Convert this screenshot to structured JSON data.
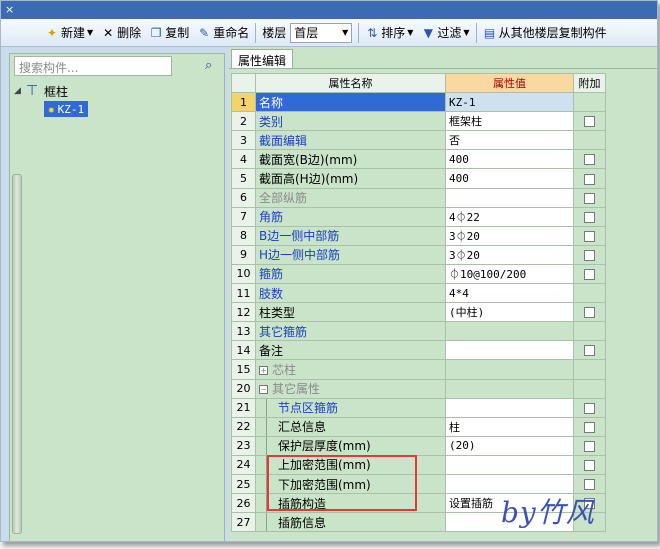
{
  "window": {
    "close_glyph": "×"
  },
  "toolbar": {
    "new": "新建",
    "delete": "删除",
    "copy": "复制",
    "rename": "重命名",
    "floor_label": "楼层",
    "floor_value": "首层",
    "sort": "排序",
    "filter": "过滤",
    "copy_from_floor": "从其他楼层复制构件"
  },
  "left": {
    "search_placeholder": "搜索构件...",
    "tree": {
      "root": "框柱",
      "child": "KZ-1"
    }
  },
  "right": {
    "tab": "属性编辑",
    "headers": {
      "name": "属性名称",
      "value": "属性值",
      "extra": "附加"
    },
    "rows": [
      {
        "num": "1",
        "name": "名称",
        "value": "KZ-1",
        "color": "blue",
        "selected": true
      },
      {
        "num": "2",
        "name": "类别",
        "value": "框架柱",
        "color": "blue",
        "checkbox": true
      },
      {
        "num": "3",
        "name": "截面编辑",
        "value": "否",
        "color": "blue"
      },
      {
        "num": "4",
        "name": "截面宽(B边)(mm)",
        "value": "400",
        "color": "black",
        "checkbox": true
      },
      {
        "num": "5",
        "name": "截面高(H边)(mm)",
        "value": "400",
        "color": "black",
        "checkbox": true
      },
      {
        "num": "6",
        "name": "全部纵筋",
        "value": "",
        "color": "gray",
        "checkbox": true
      },
      {
        "num": "7",
        "name": "角筋",
        "value": "4⏀22",
        "color": "blue",
        "checkbox": true
      },
      {
        "num": "8",
        "name": "B边一侧中部筋",
        "value": "3⏀20",
        "color": "blue",
        "checkbox": true
      },
      {
        "num": "9",
        "name": "H边一侧中部筋",
        "value": "3⏀20",
        "color": "blue",
        "checkbox": true
      },
      {
        "num": "10",
        "name": "箍筋",
        "value": "⏀10@100/200",
        "color": "blue",
        "checkbox": true
      },
      {
        "num": "11",
        "name": "肢数",
        "value": "4*4",
        "color": "blue"
      },
      {
        "num": "12",
        "name": "柱类型",
        "value": "(中柱)",
        "color": "black",
        "checkbox": true
      },
      {
        "num": "13",
        "name": "其它箍筋",
        "value": "",
        "color": "blue"
      },
      {
        "num": "14",
        "name": "备注",
        "value": "",
        "color": "black",
        "checkbox": true
      },
      {
        "num": "15",
        "name": "芯柱",
        "value": "",
        "color": "gray",
        "expander": "+"
      },
      {
        "num": "20",
        "name": "其它属性",
        "value": "",
        "color": "gray",
        "expander": "−"
      },
      {
        "num": "21",
        "name": "节点区箍筋",
        "value": "",
        "color": "blue",
        "child": true,
        "checkbox": true
      },
      {
        "num": "22",
        "name": "汇总信息",
        "value": "柱",
        "color": "black",
        "child": true,
        "checkbox": true
      },
      {
        "num": "23",
        "name": "保护层厚度(mm)",
        "value": "(20)",
        "color": "black",
        "child": true,
        "checkbox": true
      },
      {
        "num": "24",
        "name": "上加密范围(mm)",
        "value": "",
        "color": "black",
        "child": true,
        "checkbox": true
      },
      {
        "num": "25",
        "name": "下加密范围(mm)",
        "value": "",
        "color": "black",
        "child": true,
        "checkbox": true
      },
      {
        "num": "26",
        "name": "插筋构造",
        "value": "设置插筋",
        "color": "black",
        "child": true,
        "checkbox": true
      },
      {
        "num": "27",
        "name": "插筋信息",
        "value": "",
        "color": "black",
        "child": true
      }
    ]
  },
  "signature": "by竹风"
}
